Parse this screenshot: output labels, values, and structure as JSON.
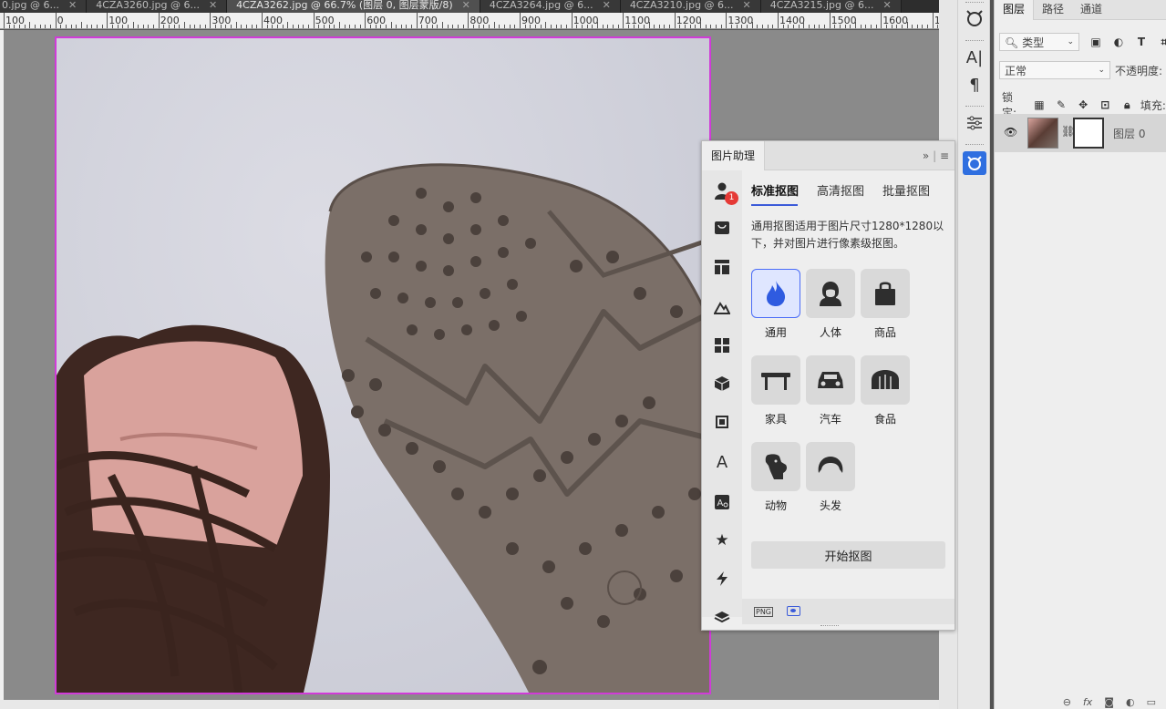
{
  "tabs": [
    {
      "label": "0.jpg @ 6...",
      "active": false
    },
    {
      "label": "4CZA3260.jpg @ 6...",
      "active": false
    },
    {
      "label": "4CZA3262.jpg @ 66.7% (图层 0, 图层蒙版/8)",
      "active": true
    },
    {
      "label": "4CZA3264.jpg @ 6...",
      "active": false
    },
    {
      "label": "4CZA3210.jpg @ 6...",
      "active": false
    },
    {
      "label": "4CZA3215.jpg @ 6...",
      "active": false
    }
  ],
  "ruler": {
    "labels": [
      "100",
      "0",
      "100",
      "200",
      "300",
      "400",
      "500",
      "600",
      "700",
      "800",
      "900",
      "1000",
      "1100",
      "1200",
      "1300",
      "1400",
      "1500",
      "1600",
      "17"
    ]
  },
  "layers_panel": {
    "tabs": [
      "图层",
      "路径",
      "通道"
    ],
    "filter_label": "类型",
    "blend_mode": "正常",
    "opacity_label": "不透明度:",
    "lock_label": "锁定:",
    "fill_label": "填充:",
    "layer_name": "图层 0"
  },
  "plugin": {
    "title": "图片助理",
    "notification_count": "1",
    "tabs": [
      "标准抠图",
      "高清抠图",
      "批量抠图"
    ],
    "description": "通用抠图适用于图片尺寸1280*1280以下，并对图片进行像素级抠图。",
    "categories": [
      {
        "label": "通用",
        "icon": "flame-icon",
        "selected": true
      },
      {
        "label": "人体",
        "icon": "person-icon",
        "selected": false
      },
      {
        "label": "商品",
        "icon": "shopping-bag-icon",
        "selected": false
      },
      {
        "label": "家具",
        "icon": "table-icon",
        "selected": false
      },
      {
        "label": "汽车",
        "icon": "car-icon",
        "selected": false
      },
      {
        "label": "食品",
        "icon": "bread-icon",
        "selected": false
      },
      {
        "label": "动物",
        "icon": "dog-icon",
        "selected": false
      },
      {
        "label": "头发",
        "icon": "hair-icon",
        "selected": false
      }
    ],
    "start_button": "开始抠图",
    "footer_png": "PNG"
  },
  "colors": {
    "accent": "#3b5bd9",
    "selection_border": "#d03bd8",
    "badge": "#e53935"
  }
}
